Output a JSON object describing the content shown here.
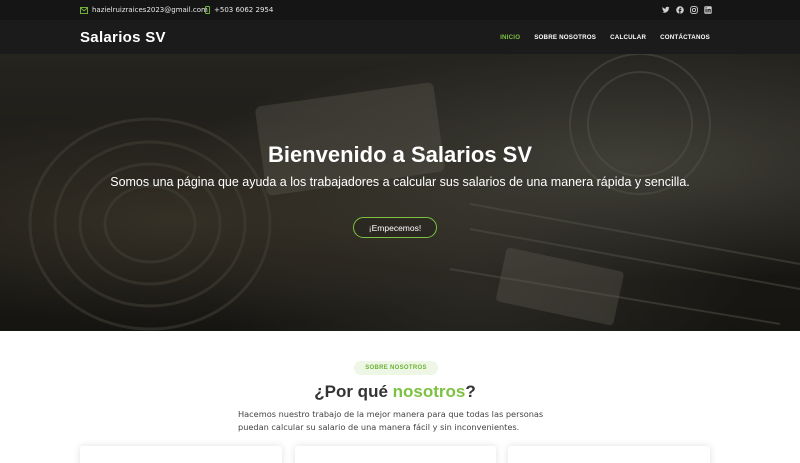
{
  "topbar": {
    "email": "hazielruizraices2023@gmail.com",
    "phone": "+503 6062 2954",
    "socials": [
      "twitter-icon",
      "facebook-icon",
      "instagram-icon",
      "linkedin-icon"
    ]
  },
  "nav": {
    "brand": "Salarios SV",
    "items": [
      {
        "label": "INICIO",
        "active": true
      },
      {
        "label": "SOBRE NOSOTROS",
        "active": false
      },
      {
        "label": "CALCULAR",
        "active": false
      },
      {
        "label": "CONTÁCTANOS",
        "active": false
      }
    ]
  },
  "hero": {
    "title": "Bienvenido a Salarios SV",
    "subtitle": "Somos una página que ayuda a los trabajadores a calcular sus salarios de una manera rápida y sencilla.",
    "cta": "¡Empecemos!"
  },
  "about": {
    "badge": "SOBRE NOSOTROS",
    "title_prefix": "¿Por qué ",
    "title_highlight": "nosotros",
    "title_suffix": "?",
    "text": "Hacemos nuestro trabajo de la mejor manera para que todas las personas puedan calcular su salario de una manera fácil y sin inconvenientes."
  },
  "colors": {
    "accent": "#7cc142",
    "topbar_bg": "#151515",
    "navbar_bg": "#1b1b1b"
  }
}
